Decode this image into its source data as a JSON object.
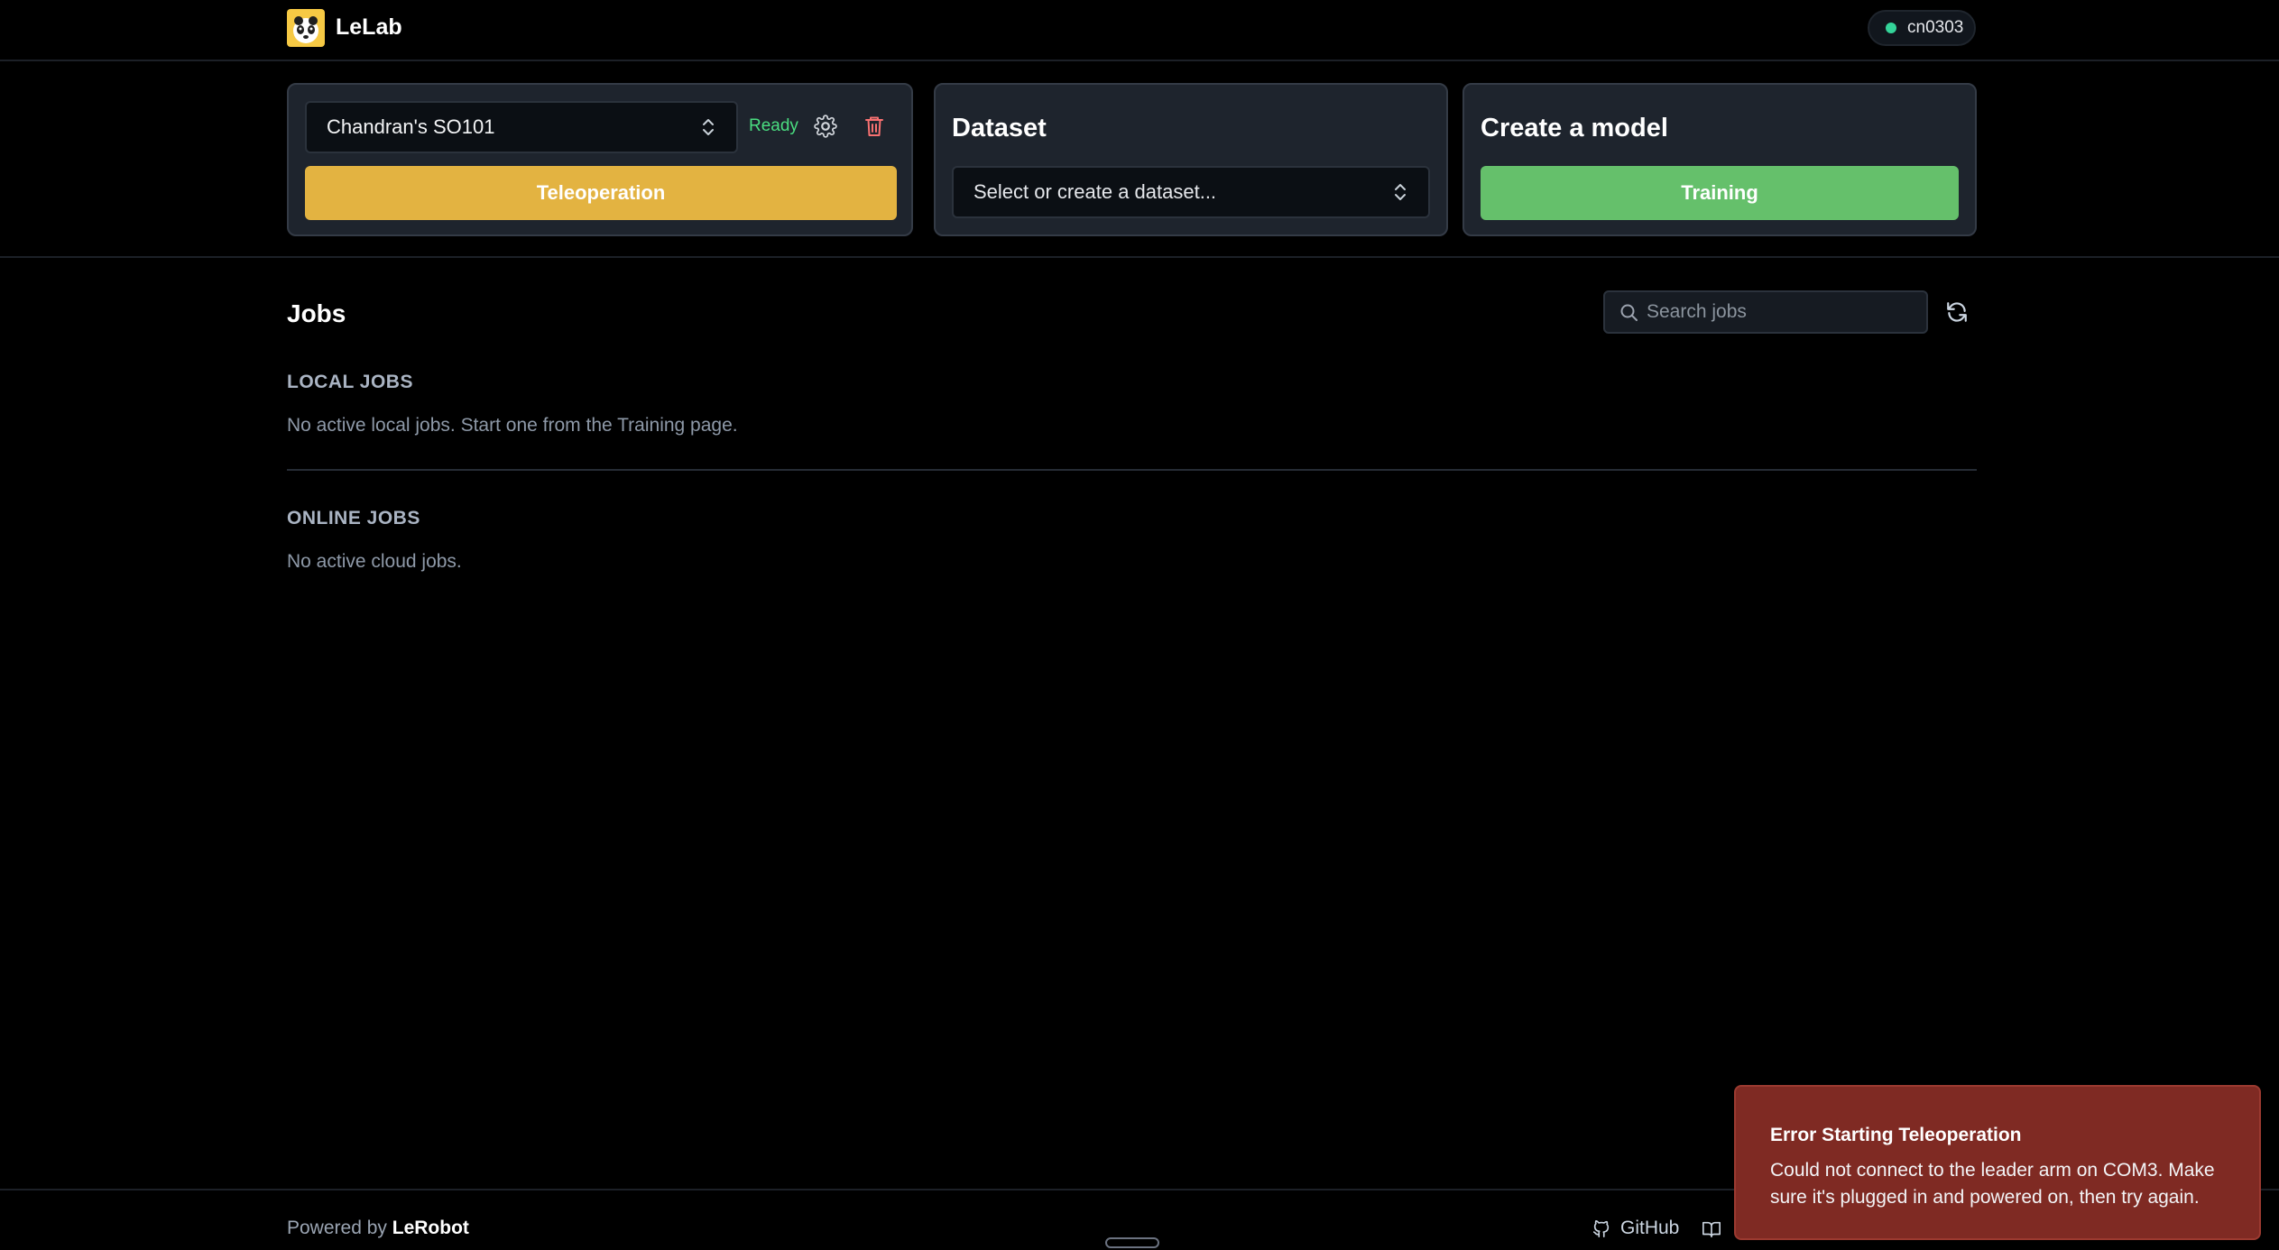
{
  "header": {
    "brand": "LeLab",
    "user": "cn0303",
    "user_status_color": "#34d399"
  },
  "robot_card": {
    "selected_robot": "Chandran's SO101",
    "status": "Ready",
    "teleop_label": "Teleoperation",
    "icons": [
      "chevron-updown-icon",
      "gear-icon",
      "trash-icon"
    ]
  },
  "dataset_card": {
    "title": "Dataset",
    "select_value": "Select or create a dataset..."
  },
  "model_card": {
    "title": "Create a model",
    "train_label": "Training"
  },
  "jobs": {
    "title": "Jobs",
    "search_placeholder": "Search jobs",
    "local_label": "LOCAL JOBS",
    "local_empty": "No active local jobs. Start one from the Training page.",
    "online_label": "ONLINE JOBS",
    "online_empty": "No active cloud jobs."
  },
  "footer": {
    "powered_prefix": "Powered by",
    "powered_brand": "LeRobot",
    "github_label": "GitHub"
  },
  "toast": {
    "title": "Error Starting Teleoperation",
    "message": "Could not connect to the leader arm on COM3. Make sure it's plugged in and powered on, then try again."
  },
  "colors": {
    "teleop": "#e3b341",
    "training": "#65c06b",
    "ready": "#4ade80",
    "error": "#7f2a23"
  }
}
